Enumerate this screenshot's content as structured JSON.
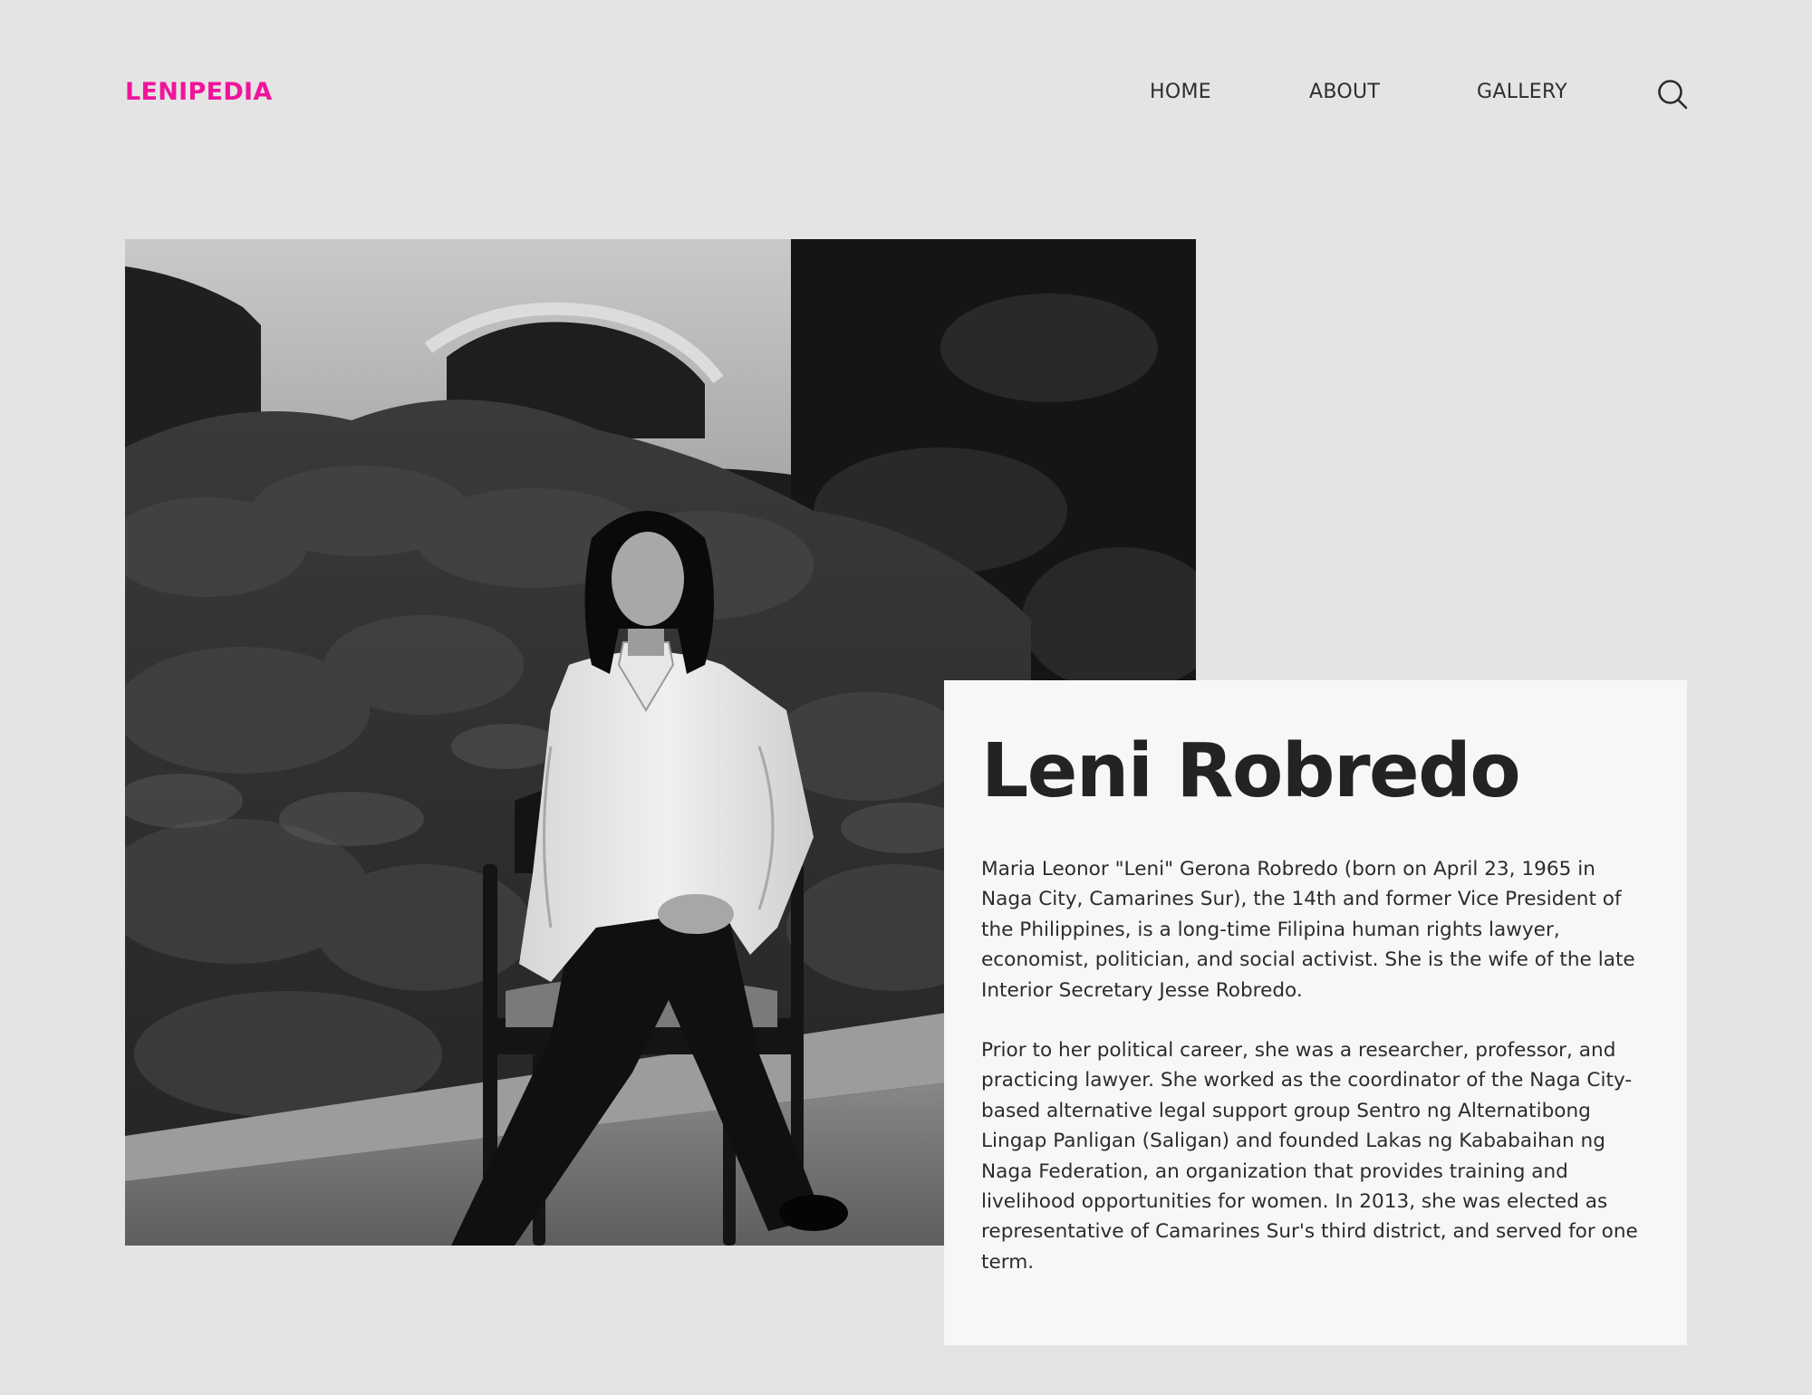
{
  "header": {
    "brand": "LENIPEDIA",
    "nav": [
      {
        "label": "HOME"
      },
      {
        "label": "ABOUT"
      },
      {
        "label": "GALLERY"
      }
    ],
    "search_icon": "search-icon"
  },
  "hero": {
    "photo_alt": "Leni Robredo seated on a wooden chair in a garden",
    "title": "Leni Robredo",
    "paragraphs": [
      "Maria Leonor \"Leni\" Gerona Robredo (born on April 23, 1965 in Naga City, Camarines Sur), the 14th and former Vice President of the Philippines, is a long-time Filipina human rights lawyer, economist, politician, and social activist. She is the wife of the late Interior Secretary Jesse Robredo.",
      "Prior to her political career, she was a researcher, professor, and practicing lawyer. She worked as the coordinator of the Naga City-based alternative legal support group Sentro ng Alternatibong Lingap Panligan (Saligan) and founded Lakas ng Kababaihan ng Naga Federation, an organization that provides training and livelihood opportunities for women. In 2013, she was elected as representative of Camarines Sur's third district, and served for one term."
    ]
  },
  "colors": {
    "background": "#e4e4e4",
    "brand": "#f0149a",
    "card": "#f7f7f7",
    "text": "#262626"
  }
}
